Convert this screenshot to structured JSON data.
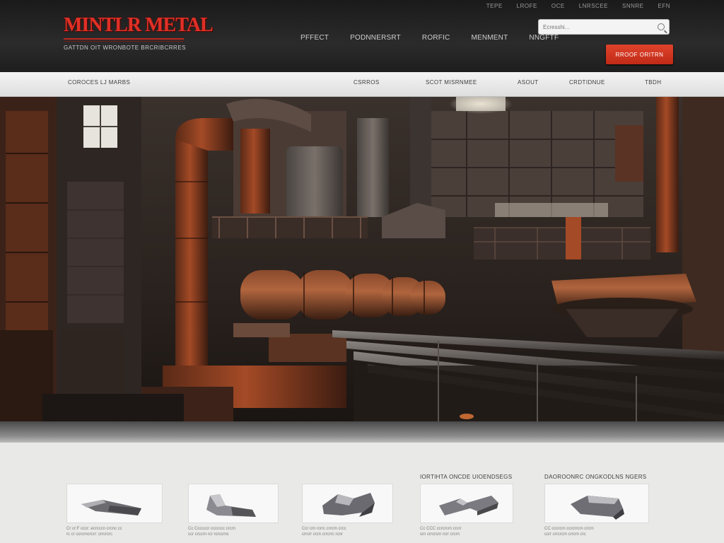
{
  "brand": {
    "title": "MINTLR METAL",
    "tagline": "GATTDN  OIT  WRONBOTE  BRCRIBCRRES"
  },
  "top_links": [
    "TEPE",
    "LROFE",
    "OCE",
    "LNRSCEE",
    "SNNRE",
    "EFN"
  ],
  "main_nav": [
    "PFFECT",
    "PODNNERSRT",
    "RORFIC",
    "MENMENT",
    "NNGFTF"
  ],
  "search": {
    "placeholder": "Ecresshi..."
  },
  "cta": {
    "label": "RROOF  ORITRN"
  },
  "subnav": {
    "brand": "COROCES LJ MARBS",
    "items": [
      "CSRROS",
      "SCOT MISRNMEE",
      "ASOUT",
      "CRDTIDNUE",
      "TBDH"
    ]
  },
  "products": [
    {
      "heading": "",
      "text": [
        "Cr cr:F cccr: ecrcccn crcnc cc",
        "rc cr ccrcrncrcrr: crrcrcrc"
      ]
    },
    {
      "heading": "",
      "text": [
        "Cc Ccccccr cccrccc crcrn",
        "ccr crccrn rcr rcrccrnc"
      ]
    },
    {
      "heading": "",
      "text": [
        "Ccr crn rcrrc crrcrn crcc",
        "crrcrr crcn crrcrrc rcnr"
      ]
    },
    {
      "heading": "IORTIHTA  ONCDE  UIOENDSEGS",
      "text": [
        "Cc  CCC ccrcrcrn crcrr",
        "crn crrcrcrn rcrr crcrn"
      ]
    },
    {
      "heading": "DAOROONRC  ONGKODLNS  NGERS",
      "text": [
        "CC  cccrcrn ccrcrrcrn crcrn",
        "ccrr crrcrcrn crrcrn crc"
      ]
    }
  ],
  "colors": {
    "accent": "#e03026",
    "header_bg": "#1f1f1f",
    "cta": "#d03520",
    "subnav_bg": "#e8e8e8"
  },
  "icons": [
    "search-icon"
  ]
}
